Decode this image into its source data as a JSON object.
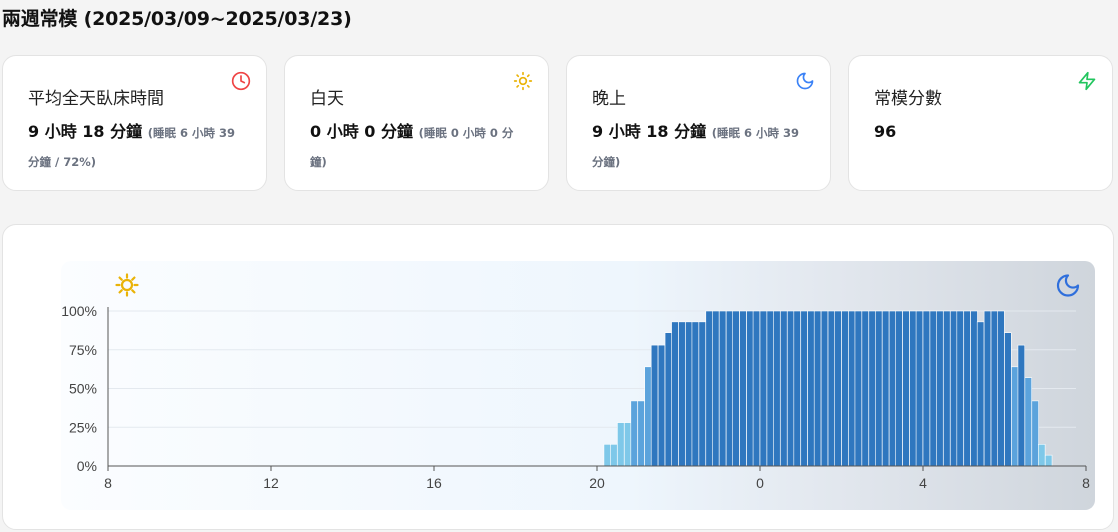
{
  "header": {
    "title": "兩週常模 (2025/03/09~2025/03/23)"
  },
  "cards": [
    {
      "label": "平均全天臥床時間",
      "value": "9 小時 18 分鐘",
      "sub": "(睡眠 6 小時 39 分鐘 / 72%)",
      "icon": "clock-icon",
      "icon_color": "#ef4444"
    },
    {
      "label": "白天",
      "value": "0 小時 0 分鐘",
      "sub": "(睡眠 0 小時 0 分鐘)",
      "icon": "sun-icon",
      "icon_color": "#eab308"
    },
    {
      "label": "晚上",
      "value": "9 小時 18 分鐘",
      "sub": "(睡眠 6 小時 39 分鐘)",
      "icon": "moon-icon",
      "icon_color": "#3b82f6"
    },
    {
      "label": "常模分數",
      "value": "96",
      "sub": "",
      "icon": "zap-icon",
      "icon_color": "#22c55e"
    }
  ],
  "chart_data": {
    "type": "bar",
    "x_ticks": [
      "8",
      "12",
      "16",
      "20",
      "0",
      "4",
      "8"
    ],
    "x_range_hours": [
      8,
      32
    ],
    "y_ticks": [
      "0%",
      "25%",
      "50%",
      "75%",
      "100%"
    ],
    "ylim": [
      0,
      100
    ],
    "bin_minutes": 10,
    "grid": true,
    "day_icon": "sun-icon",
    "night_icon": "moon-icon",
    "colors": {
      "light": "#7ec8e9",
      "medium": "#5ba3dc",
      "dark": "#2f77bf",
      "border": "#ffffff"
    },
    "bars": [
      {
        "x": 20.17,
        "v": 14
      },
      {
        "x": 20.33,
        "v": 14
      },
      {
        "x": 20.5,
        "v": 28
      },
      {
        "x": 20.67,
        "v": 28
      },
      {
        "x": 20.83,
        "v": 42
      },
      {
        "x": 21.0,
        "v": 42
      },
      {
        "x": 21.17,
        "v": 64
      },
      {
        "x": 21.33,
        "v": 78
      },
      {
        "x": 21.5,
        "v": 78
      },
      {
        "x": 21.67,
        "v": 86
      },
      {
        "x": 21.83,
        "v": 93
      },
      {
        "x": 22.0,
        "v": 93
      },
      {
        "x": 22.17,
        "v": 93
      },
      {
        "x": 22.33,
        "v": 93
      },
      {
        "x": 22.5,
        "v": 93
      },
      {
        "x": 22.67,
        "v": 100
      },
      {
        "x": 22.83,
        "v": 100
      },
      {
        "x": 23.0,
        "v": 100
      },
      {
        "x": 23.17,
        "v": 100
      },
      {
        "x": 23.33,
        "v": 100
      },
      {
        "x": 23.5,
        "v": 100
      },
      {
        "x": 23.67,
        "v": 100
      },
      {
        "x": 23.83,
        "v": 100
      },
      {
        "x": 24.0,
        "v": 100
      },
      {
        "x": 24.17,
        "v": 100
      },
      {
        "x": 24.33,
        "v": 100
      },
      {
        "x": 24.5,
        "v": 100
      },
      {
        "x": 24.67,
        "v": 100
      },
      {
        "x": 24.83,
        "v": 100
      },
      {
        "x": 25.0,
        "v": 100
      },
      {
        "x": 25.17,
        "v": 100
      },
      {
        "x": 25.33,
        "v": 100
      },
      {
        "x": 25.5,
        "v": 100
      },
      {
        "x": 25.67,
        "v": 100
      },
      {
        "x": 25.83,
        "v": 100
      },
      {
        "x": 26.0,
        "v": 100
      },
      {
        "x": 26.17,
        "v": 100
      },
      {
        "x": 26.33,
        "v": 100
      },
      {
        "x": 26.5,
        "v": 100
      },
      {
        "x": 26.67,
        "v": 100
      },
      {
        "x": 26.83,
        "v": 100
      },
      {
        "x": 27.0,
        "v": 100
      },
      {
        "x": 27.17,
        "v": 100
      },
      {
        "x": 27.33,
        "v": 100
      },
      {
        "x": 27.5,
        "v": 100
      },
      {
        "x": 27.67,
        "v": 100
      },
      {
        "x": 27.83,
        "v": 100
      },
      {
        "x": 28.0,
        "v": 100
      },
      {
        "x": 28.17,
        "v": 100
      },
      {
        "x": 28.33,
        "v": 100
      },
      {
        "x": 28.5,
        "v": 100
      },
      {
        "x": 28.67,
        "v": 100
      },
      {
        "x": 28.83,
        "v": 100
      },
      {
        "x": 29.0,
        "v": 100
      },
      {
        "x": 29.17,
        "v": 100
      },
      {
        "x": 29.33,
        "v": 93
      },
      {
        "x": 29.5,
        "v": 100
      },
      {
        "x": 29.67,
        "v": 100
      },
      {
        "x": 29.83,
        "v": 100
      },
      {
        "x": 30.0,
        "v": 86
      },
      {
        "x": 30.17,
        "v": 64
      },
      {
        "x": 30.33,
        "v": 78
      },
      {
        "x": 30.5,
        "v": 57
      },
      {
        "x": 30.67,
        "v": 42
      },
      {
        "x": 30.83,
        "v": 14
      },
      {
        "x": 31.0,
        "v": 7
      }
    ]
  }
}
